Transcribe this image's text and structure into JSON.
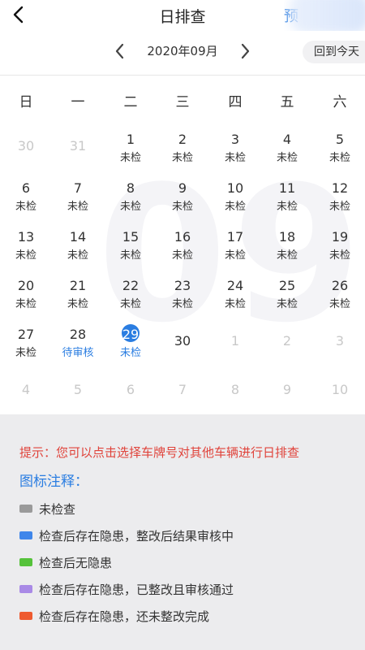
{
  "header": {
    "title": "日排查",
    "right_text": "预"
  },
  "month_nav": {
    "label": "2020年09月",
    "today_button": "回到今天"
  },
  "weekdays": [
    "日",
    "一",
    "二",
    "三",
    "四",
    "五",
    "六"
  ],
  "watermark": "09",
  "calendar": [
    [
      {
        "day": "30",
        "status": ""
      },
      {
        "day": "31",
        "status": ""
      },
      {
        "day": "1",
        "status": "未检"
      },
      {
        "day": "2",
        "status": "未检"
      },
      {
        "day": "3",
        "status": "未检"
      },
      {
        "day": "4",
        "status": "未检"
      },
      {
        "day": "5",
        "status": "未检"
      }
    ],
    [
      {
        "day": "6",
        "status": "未检"
      },
      {
        "day": "7",
        "status": "未检"
      },
      {
        "day": "8",
        "status": "未检"
      },
      {
        "day": "9",
        "status": "未检"
      },
      {
        "day": "10",
        "status": "未检"
      },
      {
        "day": "11",
        "status": "未检"
      },
      {
        "day": "12",
        "status": "未检"
      }
    ],
    [
      {
        "day": "13",
        "status": "未检"
      },
      {
        "day": "14",
        "status": "未检"
      },
      {
        "day": "15",
        "status": "未检"
      },
      {
        "day": "16",
        "status": "未检"
      },
      {
        "day": "17",
        "status": "未检"
      },
      {
        "day": "18",
        "status": "未检"
      },
      {
        "day": "19",
        "status": "未检"
      }
    ],
    [
      {
        "day": "20",
        "status": "未检"
      },
      {
        "day": "21",
        "status": "未检"
      },
      {
        "day": "22",
        "status": "未检"
      },
      {
        "day": "23",
        "status": "未检"
      },
      {
        "day": "24",
        "status": "未检"
      },
      {
        "day": "25",
        "status": "未检"
      },
      {
        "day": "26",
        "status": "未检"
      }
    ],
    [
      {
        "day": "27",
        "status": "未检"
      },
      {
        "day": "28",
        "status": "待审核"
      },
      {
        "day": "29",
        "status": "未检"
      },
      {
        "day": "30",
        "status": ""
      },
      {
        "day": "1",
        "status": ""
      },
      {
        "day": "2",
        "status": ""
      },
      {
        "day": "3",
        "status": ""
      }
    ],
    [
      {
        "day": "4",
        "status": ""
      },
      {
        "day": "5",
        "status": ""
      },
      {
        "day": "6",
        "status": ""
      },
      {
        "day": "7",
        "status": ""
      },
      {
        "day": "8",
        "status": ""
      },
      {
        "day": "9",
        "status": ""
      },
      {
        "day": "10",
        "status": ""
      }
    ]
  ],
  "tip": "提示：您可以点击选择车牌号对其他车辆进行日排查",
  "legend": {
    "title": "图标注释：",
    "items": [
      {
        "color": "#9a9a9a",
        "label": "未检查"
      },
      {
        "color": "#3f86ea",
        "label": "检查后存在隐患，整改后结果审核中"
      },
      {
        "color": "#55c23a",
        "label": "检查后无隐患"
      },
      {
        "color": "#a98ae6",
        "label": "检查后存在隐患，已整改且审核通过"
      },
      {
        "color": "#ee5a2f",
        "label": "检查后存在隐患，还未整改完成"
      }
    ]
  }
}
